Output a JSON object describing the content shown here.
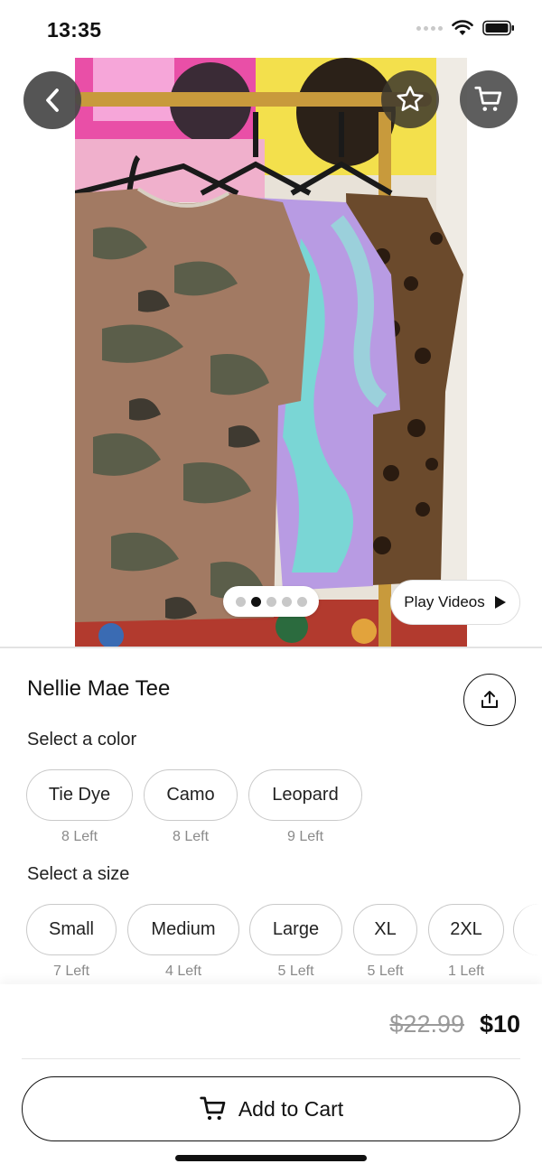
{
  "status_bar": {
    "time": "13:35"
  },
  "product": {
    "title": "Nellie Mae Tee",
    "image_dots": {
      "count": 5,
      "active_index": 1
    },
    "play_videos_label": "Play Videos"
  },
  "color_section": {
    "label": "Select a color",
    "options": [
      {
        "label": "Tie Dye",
        "stock": "8 Left"
      },
      {
        "label": "Camo",
        "stock": "8 Left"
      },
      {
        "label": "Leopard",
        "stock": "9 Left"
      }
    ]
  },
  "size_section": {
    "label": "Select a size",
    "options": [
      {
        "label": "Small",
        "stock": "7 Left"
      },
      {
        "label": "Medium",
        "stock": "4 Left"
      },
      {
        "label": "Large",
        "stock": "5 Left"
      },
      {
        "label": "XL",
        "stock": "5 Left"
      },
      {
        "label": "2XL",
        "stock": "1 Left"
      }
    ]
  },
  "pricing": {
    "original": "$22.99",
    "sale": "$10"
  },
  "cta": {
    "add_to_cart_label": "Add to Cart"
  },
  "icons": {
    "back": "chevron-left-icon",
    "favorite": "star-icon",
    "cart": "cart-icon",
    "share": "share-icon",
    "play": "play-icon"
  }
}
